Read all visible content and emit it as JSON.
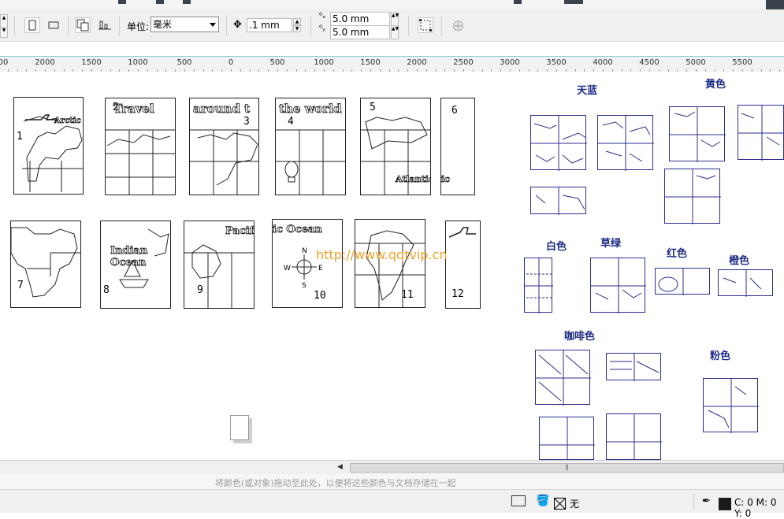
{
  "toolbar": {
    "unit_label": "单位:",
    "unit_value": "毫米",
    "nudge_value": ".1 mm",
    "dup_x_value": "5.0 mm",
    "dup_y_value": "5.0 mm"
  },
  "ruler": {
    "labels": [
      "00",
      "2000",
      "1500",
      "1000",
      "500",
      "0",
      "500",
      "1000",
      "1500",
      "2000",
      "2500",
      "3000",
      "3500",
      "4000",
      "4500",
      "5000",
      "5500"
    ]
  },
  "cards_top": [
    {
      "num": "1",
      "title": "Arctic"
    },
    {
      "num": "2",
      "title": "Travel"
    },
    {
      "num": "3",
      "title": "around t"
    },
    {
      "num": "4",
      "title": "the world"
    },
    {
      "num": "5",
      "title": "Atlantic"
    },
    {
      "num": "6",
      "title": "ic"
    }
  ],
  "cards_bottom": [
    {
      "num": "7",
      "title": ""
    },
    {
      "num": "8",
      "title": "Indian Ocean"
    },
    {
      "num": "9",
      "title": "Pacific"
    },
    {
      "num": "10",
      "title": "ic Ocean"
    },
    {
      "num": "11",
      "title": ""
    },
    {
      "num": "12",
      "title": ""
    }
  ],
  "color_groups": {
    "sky_blue": "天蓝",
    "yellow": "黄色",
    "white": "白色",
    "grass_green": "草绿",
    "red": "红色",
    "orange": "橙色",
    "coffee": "咖啡色",
    "pink": "粉色"
  },
  "watermark": "http://www.qqtvip.cn",
  "palette_hint": "将颜色(或对象)拖动至此处，以便将这些颜色与文档存储在一起",
  "status": {
    "fill_none": "无",
    "color_readout": "C: 0 M: 0 Y: 0"
  },
  "colors": {
    "accent_blue": "#1d2a86",
    "watermark_orange": "#f0a128"
  }
}
